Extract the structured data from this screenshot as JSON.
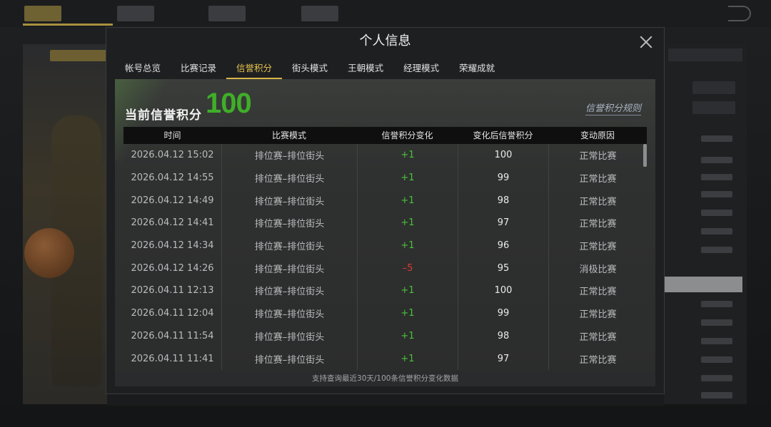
{
  "modal": {
    "title": "个人信息"
  },
  "tabs": [
    {
      "label": "帐号总览",
      "active": false
    },
    {
      "label": "比赛记录",
      "active": false
    },
    {
      "label": "信誉积分",
      "active": true
    },
    {
      "label": "街头模式",
      "active": false
    },
    {
      "label": "王朝模式",
      "active": false
    },
    {
      "label": "经理模式",
      "active": false
    },
    {
      "label": "荣耀成就",
      "active": false
    }
  ],
  "score": {
    "label": "当前信誉积分",
    "value": "100",
    "rules_link": "信誉积分规则"
  },
  "table": {
    "headers": [
      "时间",
      "比赛模式",
      "信誉积分变化",
      "变化后信誉积分",
      "变动原因"
    ],
    "rows": [
      {
        "time": "2026.04.12  15:02",
        "mode": "排位赛–排位街头",
        "delta": "+1",
        "after": "100",
        "reason": "正常比赛"
      },
      {
        "time": "2026.04.12  14:55",
        "mode": "排位赛–排位街头",
        "delta": "+1",
        "after": "99",
        "reason": "正常比赛"
      },
      {
        "time": "2026.04.12  14:49",
        "mode": "排位赛–排位街头",
        "delta": "+1",
        "after": "98",
        "reason": "正常比赛"
      },
      {
        "time": "2026.04.12  14:41",
        "mode": "排位赛–排位街头",
        "delta": "+1",
        "after": "97",
        "reason": "正常比赛"
      },
      {
        "time": "2026.04.12  14:34",
        "mode": "排位赛–排位街头",
        "delta": "+1",
        "after": "96",
        "reason": "正常比赛"
      },
      {
        "time": "2026.04.12  14:26",
        "mode": "排位赛–排位街头",
        "delta": "–5",
        "after": "95",
        "reason": "消极比赛"
      },
      {
        "time": "2026.04.11  12:13",
        "mode": "排位赛–排位街头",
        "delta": "+1",
        "after": "100",
        "reason": "正常比赛"
      },
      {
        "time": "2026.04.11  12:04",
        "mode": "排位赛–排位街头",
        "delta": "+1",
        "after": "99",
        "reason": "正常比赛"
      },
      {
        "time": "2026.04.11  11:54",
        "mode": "排位赛–排位街头",
        "delta": "+1",
        "after": "98",
        "reason": "正常比赛"
      },
      {
        "time": "2026.04.11  11:41",
        "mode": "排位赛–排位街头",
        "delta": "+1",
        "after": "97",
        "reason": "正常比赛"
      }
    ]
  },
  "footnote": "支持查询最近30天/100条信誉积分变化数据",
  "colors": {
    "accent": "#d8b648",
    "score_green": "#3fae28",
    "delta_positive": "#49c13a",
    "delta_negative": "#e0392f"
  }
}
